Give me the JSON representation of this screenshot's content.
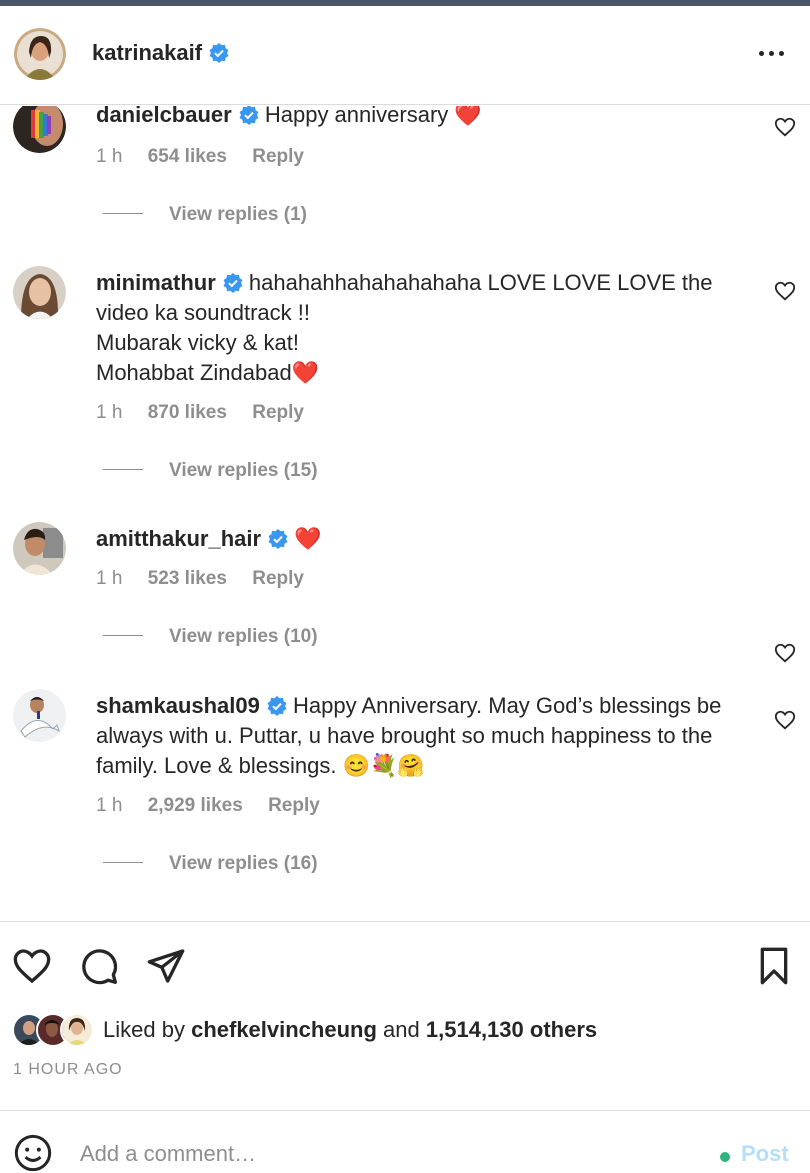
{
  "header": {
    "username": "katrinakaif"
  },
  "comments": [
    {
      "username": "danielcbauer",
      "text": "Happy anniversary ❤️",
      "time": "1 h",
      "likes": "654 likes",
      "reply": "Reply",
      "view_replies": "View replies (1)"
    },
    {
      "username": "minimathur",
      "text": "hahahahhahahahahaha LOVE LOVE LOVE the video ka soundtrack !!\nMubarak vicky & kat!\nMohabbat Zindabad❤️",
      "time": "1 h",
      "likes": "870 likes",
      "reply": "Reply",
      "view_replies": "View replies (15)"
    },
    {
      "username": "amitthakur_hair",
      "text": "❤️",
      "time": "1 h",
      "likes": "523 likes",
      "reply": "Reply",
      "view_replies": "View replies (10)"
    },
    {
      "username": "shamkaushal09",
      "text": "Happy Anniversary. May God’s blessings be always with u. Puttar, u have brought so much happiness to the family. Love & blessings. 😊💐🤗",
      "time": "1 h",
      "likes": "2,929 likes",
      "reply": "Reply",
      "view_replies": "View replies (16)"
    }
  ],
  "liked_by": {
    "prefix": "Liked by",
    "user": "chefkelvincheung",
    "and": "and",
    "others": "1,514,130 others"
  },
  "timestamp": "1 HOUR AGO",
  "comment_box": {
    "placeholder": "Add a comment…",
    "post_label": "Post"
  },
  "colors": {
    "verified": "#3897f0",
    "muted": "#8e8e8e",
    "post_disabled": "#b2dffc",
    "text": "#262626"
  },
  "icons": [
    "more-icon",
    "heart-icon",
    "comment-icon",
    "share-icon",
    "bookmark-icon",
    "emoji-icon",
    "verified-badge-icon"
  ]
}
